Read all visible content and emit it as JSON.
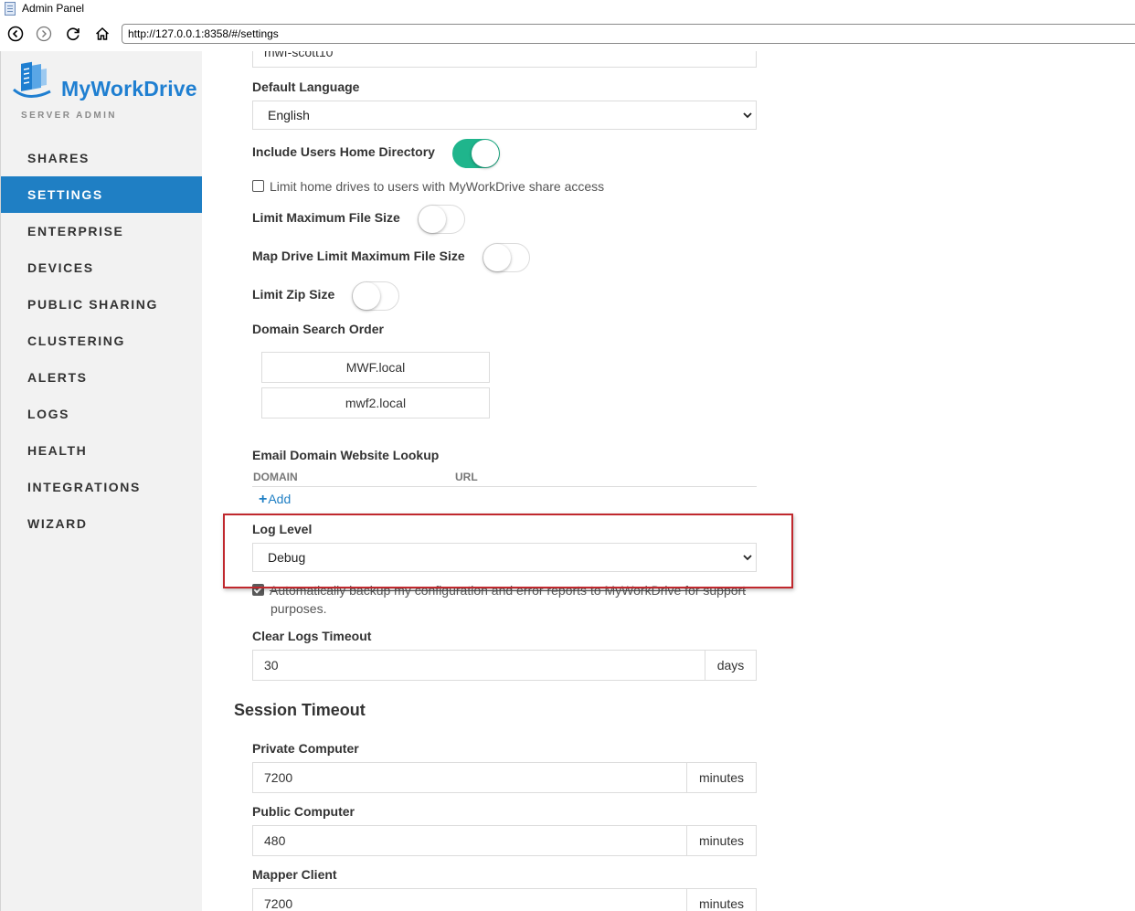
{
  "window": {
    "title": "Admin Panel"
  },
  "browser": {
    "url": "http://127.0.0.1:8358/#/settings"
  },
  "brand": {
    "name": "MyWorkDrive",
    "subtitle": "SERVER ADMIN",
    "color": "#1f7fd1"
  },
  "nav": {
    "items": [
      {
        "label": "SHARES"
      },
      {
        "label": "SETTINGS",
        "active": true
      },
      {
        "label": "ENTERPRISE"
      },
      {
        "label": "DEVICES"
      },
      {
        "label": "PUBLIC SHARING"
      },
      {
        "label": "CLUSTERING"
      },
      {
        "label": "ALERTS"
      },
      {
        "label": "LOGS"
      },
      {
        "label": "HEALTH"
      },
      {
        "label": "INTEGRATIONS"
      },
      {
        "label": "WIZARD"
      }
    ]
  },
  "settings": {
    "server_name_value": "mwf-scott10",
    "default_language": {
      "label": "Default Language",
      "value": "English"
    },
    "include_home": {
      "label": "Include Users Home Directory",
      "on": true
    },
    "limit_home_drives": {
      "label": "Limit home drives to users with MyWorkDrive share access",
      "checked": false
    },
    "limit_max_file_size": {
      "label": "Limit Maximum File Size",
      "on": false
    },
    "map_drive_limit": {
      "label": "Map Drive Limit Maximum File Size",
      "on": false
    },
    "limit_zip": {
      "label": "Limit Zip Size",
      "on": false
    },
    "domain_search": {
      "label": "Domain Search Order",
      "domains": [
        "MWF.local",
        "mwf2.local"
      ]
    },
    "email_lookup": {
      "label": "Email Domain Website Lookup",
      "col_domain": "DOMAIN",
      "col_url": "URL",
      "add_label": "Add"
    },
    "log_level": {
      "label": "Log Level",
      "value": "Debug"
    },
    "auto_backup": {
      "line1": "Automatically backup my configuration and error reports to MyWorkDrive for support",
      "line2": "purposes.",
      "checked": true
    },
    "clear_logs": {
      "label": "Clear Logs Timeout",
      "value": "30",
      "unit": "days"
    }
  },
  "session": {
    "title": "Session Timeout",
    "private": {
      "label": "Private Computer",
      "value": "7200",
      "unit": "minutes"
    },
    "public": {
      "label": "Public Computer",
      "value": "480",
      "unit": "minutes"
    },
    "mapper": {
      "label": "Mapper Client",
      "value": "7200",
      "unit": "minutes"
    }
  },
  "colors": {
    "accent": "#1f7fc4",
    "toggle_on": "#1fb58c",
    "highlight": "#c0282d"
  }
}
